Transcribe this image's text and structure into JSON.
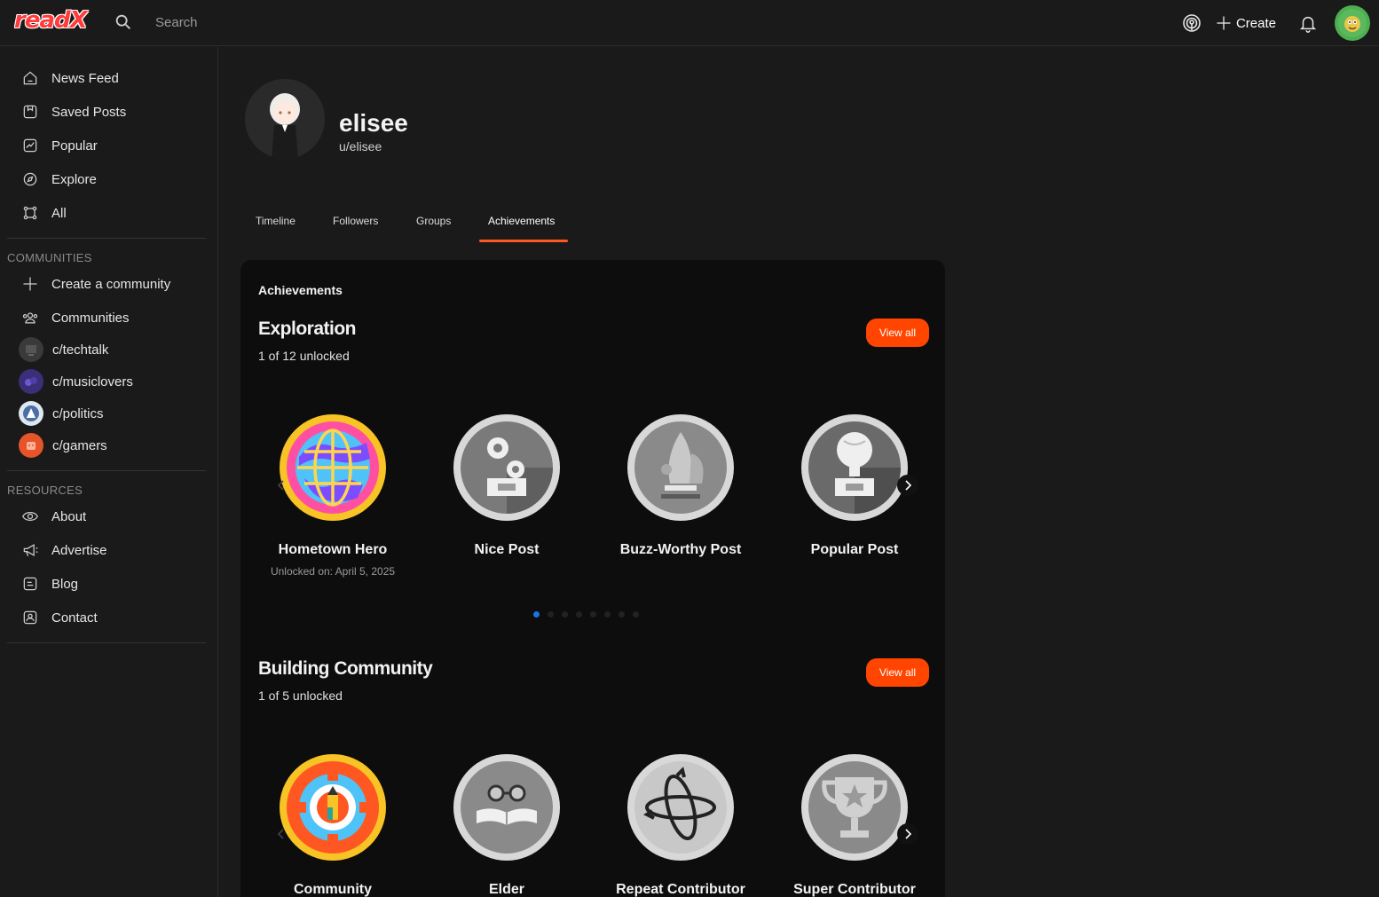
{
  "topbar": {
    "logo": "readX",
    "search_placeholder": "Search",
    "create_label": "Create"
  },
  "sidebar": {
    "nav": [
      {
        "label": "News Feed",
        "icon": "home-icon"
      },
      {
        "label": "Saved Posts",
        "icon": "save-icon"
      },
      {
        "label": "Popular",
        "icon": "trending-icon"
      },
      {
        "label": "Explore",
        "icon": "compass-icon"
      },
      {
        "label": "All",
        "icon": "nodes-icon"
      }
    ],
    "communities_label": "COMMUNITIES",
    "create_community": "Create a community",
    "communities_link": "Communities",
    "communities": [
      {
        "label": "c/techtalk",
        "color": "#3a3a3a"
      },
      {
        "label": "c/musiclovers",
        "color": "#3b2f7a"
      },
      {
        "label": "c/politics",
        "color": "#dfe7ef"
      },
      {
        "label": "c/gamers",
        "color": "#e6542a"
      }
    ],
    "resources_label": "RESOURCES",
    "resources": [
      {
        "label": "About",
        "icon": "eye-icon"
      },
      {
        "label": "Advertise",
        "icon": "megaphone-icon"
      },
      {
        "label": "Blog",
        "icon": "blog-icon"
      },
      {
        "label": "Contact",
        "icon": "contact-icon"
      }
    ]
  },
  "profile": {
    "name": "elisee",
    "handle": "u/elisee"
  },
  "tabs": [
    "Timeline",
    "Followers",
    "Groups",
    "Achievements"
  ],
  "active_tab": "Achievements",
  "achievements": {
    "title": "Achievements",
    "sections": [
      {
        "heading": "Exploration",
        "progress": "1 of 12 unlocked",
        "view_all": "View all",
        "badges": [
          {
            "name": "Hometown Hero",
            "date": "Unlocked on: April 5, 2025",
            "unlocked": true
          },
          {
            "name": "Nice Post",
            "date": "",
            "unlocked": false
          },
          {
            "name": "Buzz-Worthy Post",
            "date": "",
            "unlocked": false
          },
          {
            "name": "Popular Post",
            "date": "",
            "unlocked": false
          }
        ]
      },
      {
        "heading": "Building Community",
        "progress": "1 of 5 unlocked",
        "view_all": "View all",
        "badges": [
          {
            "name": "Community",
            "date": "",
            "unlocked": true
          },
          {
            "name": "Elder",
            "date": "",
            "unlocked": false
          },
          {
            "name": "Repeat Contributor",
            "date": "",
            "unlocked": false
          },
          {
            "name": "Super Contributor",
            "date": "",
            "unlocked": false
          }
        ]
      }
    ]
  },
  "colors": {
    "accent": "#ff4500",
    "tab_underline": "#ff5722",
    "dot_active": "#1a73e8"
  }
}
